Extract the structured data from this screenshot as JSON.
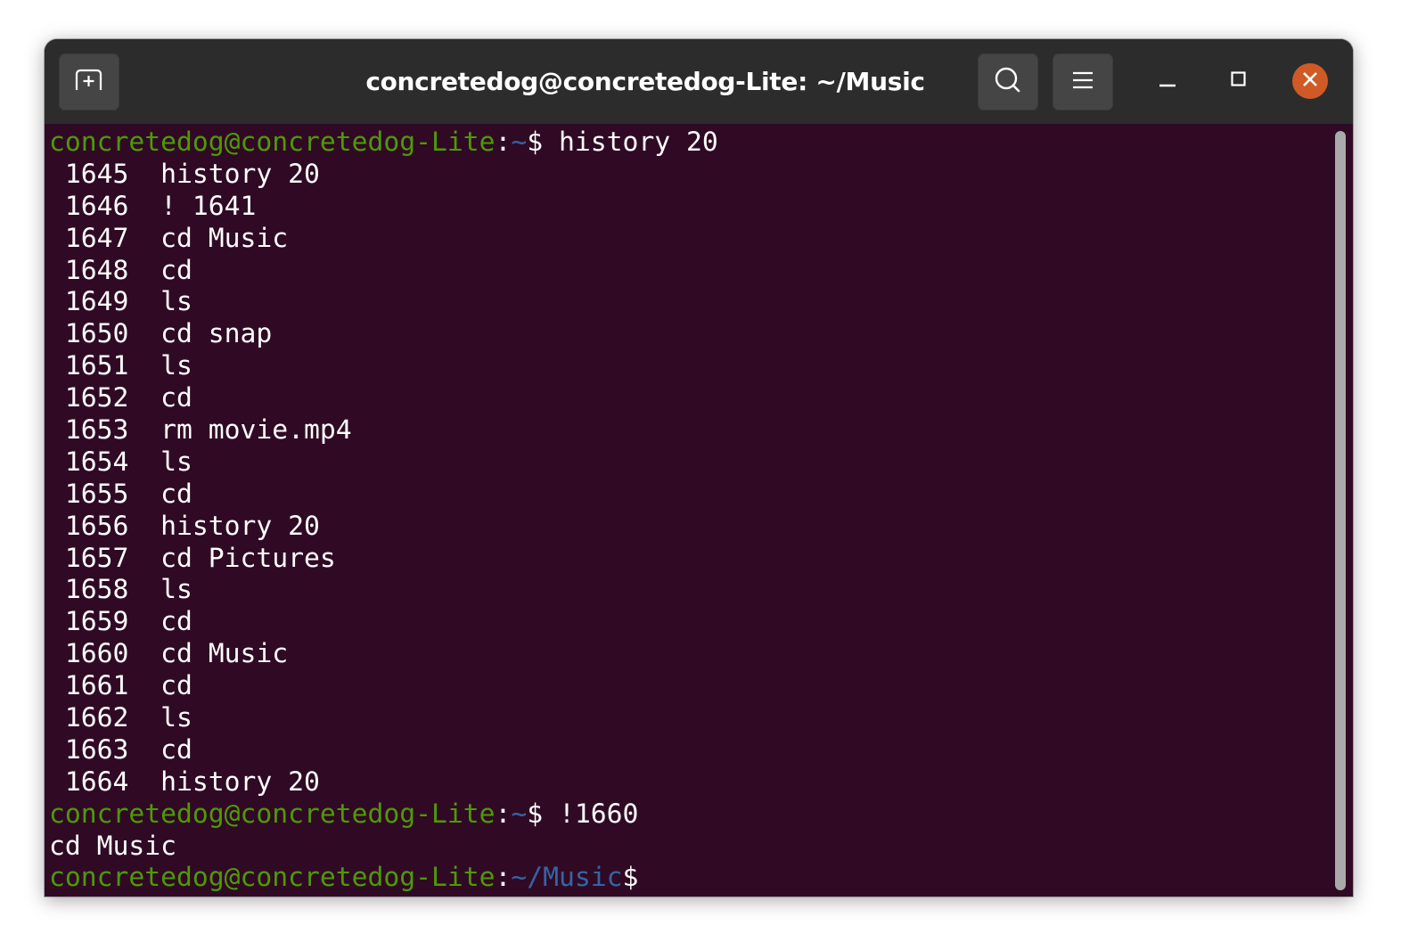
{
  "window": {
    "title": "concretedog@concretedog-Lite: ~/Music",
    "buttons": {
      "new_tab": "new-tab-icon",
      "search": "search-icon",
      "menu": "hamburger-menu-icon",
      "minimize": "minimize-icon",
      "maximize": "maximize-icon",
      "close": "close-icon"
    },
    "colors": {
      "titlebar": "#2c2c2c",
      "terminal_bg": "#300a24",
      "prompt_user": "#4e9a06",
      "prompt_path": "#3465a4",
      "close_button": "#d05a25"
    }
  },
  "terminal": {
    "prompt_user_host": "concretedog@concretedog-Lite",
    "lines": [
      {
        "type": "prompt",
        "path": "~",
        "command": "history 20"
      },
      {
        "type": "history",
        "num": "1645",
        "cmd": "history 20"
      },
      {
        "type": "history",
        "num": "1646",
        "cmd": "! 1641"
      },
      {
        "type": "history",
        "num": "1647",
        "cmd": "cd Music"
      },
      {
        "type": "history",
        "num": "1648",
        "cmd": "cd"
      },
      {
        "type": "history",
        "num": "1649",
        "cmd": "ls"
      },
      {
        "type": "history",
        "num": "1650",
        "cmd": "cd snap"
      },
      {
        "type": "history",
        "num": "1651",
        "cmd": "ls"
      },
      {
        "type": "history",
        "num": "1652",
        "cmd": "cd"
      },
      {
        "type": "history",
        "num": "1653",
        "cmd": "rm movie.mp4"
      },
      {
        "type": "history",
        "num": "1654",
        "cmd": "ls"
      },
      {
        "type": "history",
        "num": "1655",
        "cmd": "cd"
      },
      {
        "type": "history",
        "num": "1656",
        "cmd": "history 20"
      },
      {
        "type": "history",
        "num": "1657",
        "cmd": "cd Pictures"
      },
      {
        "type": "history",
        "num": "1658",
        "cmd": "ls"
      },
      {
        "type": "history",
        "num": "1659",
        "cmd": "cd"
      },
      {
        "type": "history",
        "num": "1660",
        "cmd": "cd Music"
      },
      {
        "type": "history",
        "num": "1661",
        "cmd": "cd"
      },
      {
        "type": "history",
        "num": "1662",
        "cmd": "ls"
      },
      {
        "type": "history",
        "num": "1663",
        "cmd": "cd"
      },
      {
        "type": "history",
        "num": "1664",
        "cmd": "history 20"
      },
      {
        "type": "prompt",
        "path": "~",
        "command": "!1660"
      },
      {
        "type": "output",
        "text": "cd Music"
      },
      {
        "type": "prompt",
        "path": "~/Music",
        "command": ""
      }
    ]
  }
}
